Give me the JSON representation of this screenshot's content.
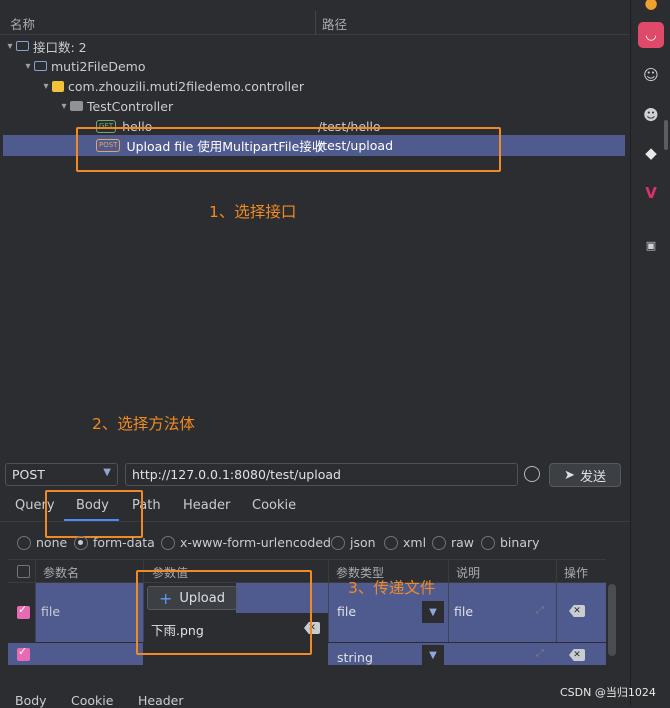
{
  "tree": {
    "col_name": "名称",
    "col_path": "路径",
    "root": {
      "label": "接口数: 2"
    },
    "module": {
      "label": "muti2FileDemo"
    },
    "package": {
      "label": "com.zhouzili.muti2filedemo.controller"
    },
    "controller": {
      "label": "TestController"
    },
    "endpoints": [
      {
        "method": "GET",
        "name": "hello",
        "path": "/test/hello"
      },
      {
        "method": "POST",
        "name": "Upload file 使用MultipartFile接收",
        "path": "/test/upload"
      }
    ]
  },
  "annotations": {
    "step1": "1、选择接口",
    "step2": "2、选择方法体",
    "step3": "3、传递文件"
  },
  "request": {
    "method": "POST",
    "url": "http://127.0.0.1:8080/test/upload",
    "send_label": "发送"
  },
  "tabs": [
    "Query",
    "Body",
    "Path",
    "Header",
    "Cookie"
  ],
  "active_tab": "Body",
  "body_types": [
    {
      "label": "none",
      "selected": false
    },
    {
      "label": "form-data",
      "selected": true
    },
    {
      "label": "x-www-form-urlencoded",
      "selected": false
    },
    {
      "label": "json",
      "selected": false
    },
    {
      "label": "xml",
      "selected": false
    },
    {
      "label": "raw",
      "selected": false
    },
    {
      "label": "binary",
      "selected": false
    }
  ],
  "table": {
    "headers": [
      "参数名",
      "参数值",
      "参数类型",
      "说明",
      "操作"
    ],
    "rows": [
      {
        "checked": true,
        "name": "file",
        "upload_label": "Upload",
        "file": "下雨.png",
        "type": "file",
        "desc": "file"
      },
      {
        "checked": true,
        "name": "",
        "type": "string",
        "desc": ""
      }
    ]
  },
  "bottom_tabs": [
    "Body",
    "Cookie",
    "Header"
  ],
  "watermark": "CSDN @当归1024",
  "colors": {
    "accent_orange": "#f08a24",
    "selection": "#4f5b8f",
    "checkbox": "#e86ab3"
  }
}
